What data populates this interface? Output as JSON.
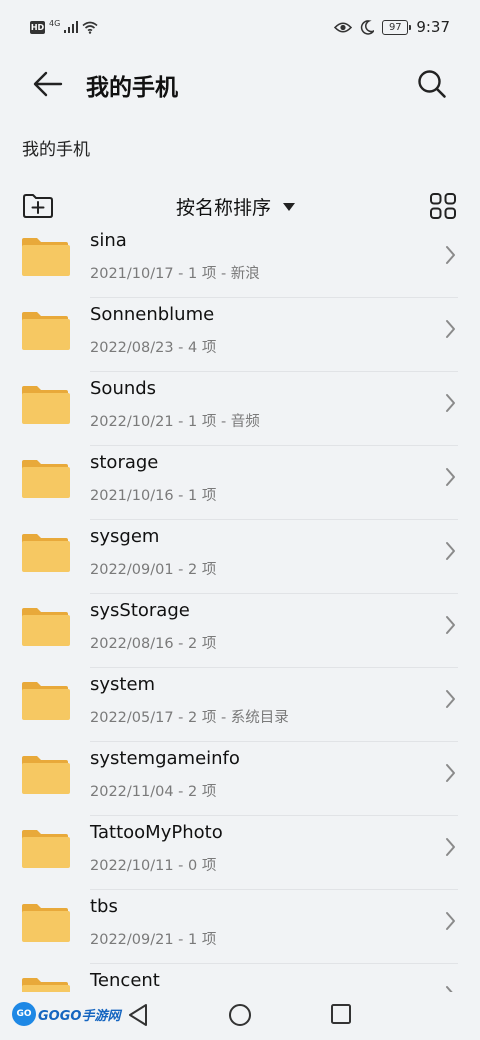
{
  "status_bar": {
    "hd_label": "HD",
    "network_label": "4G",
    "battery_level": "97",
    "time": "9:37"
  },
  "header": {
    "title": "我的手机"
  },
  "breadcrumb": "我的手机",
  "toolbar": {
    "sort_label": "按名称排序"
  },
  "files": [
    {
      "name": "sina",
      "meta": "2021/10/17 - 1 项 - 新浪"
    },
    {
      "name": "Sonnenblume",
      "meta": "2022/08/23 - 4 项"
    },
    {
      "name": "Sounds",
      "meta": "2022/10/21 - 1 项 - 音频"
    },
    {
      "name": "storage",
      "meta": "2021/10/16 - 1 项"
    },
    {
      "name": "sysgem",
      "meta": "2022/09/01 - 2 项"
    },
    {
      "name": "sysStorage",
      "meta": "2022/08/16 - 2 项"
    },
    {
      "name": "system",
      "meta": "2022/05/17 - 2 项 - 系统目录"
    },
    {
      "name": "systemgameinfo",
      "meta": "2022/11/04 - 2 项"
    },
    {
      "name": "TattooMyPhoto",
      "meta": "2022/10/11 - 0 项"
    },
    {
      "name": "tbs",
      "meta": "2022/09/21 - 1 项"
    },
    {
      "name": "Tencent",
      "meta": ""
    }
  ],
  "watermark": {
    "badge": "GO",
    "text": "GOGO手游网"
  },
  "colors": {
    "background": "#f1f3f5",
    "folder_body": "#f6c862",
    "folder_tab": "#e8a93a",
    "icon_stroke": "#222222",
    "meta_text": "#7a7a7a"
  }
}
